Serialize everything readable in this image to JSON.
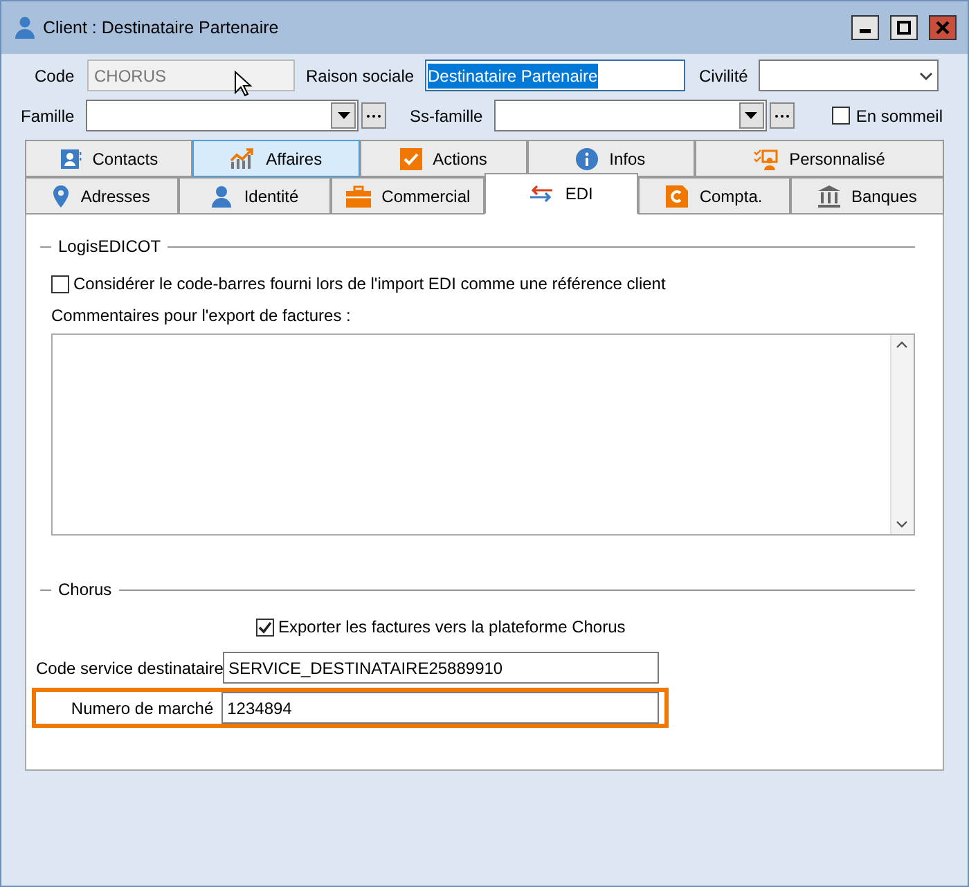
{
  "window": {
    "title": "Client : Destinataire Partenaire"
  },
  "header": {
    "code": {
      "label": "Code",
      "value": "CHORUS",
      "disabled": true
    },
    "raison_sociale": {
      "label": "Raison sociale",
      "value": "Destinataire Partenaire",
      "selected": true
    },
    "civilite": {
      "label": "Civilité"
    },
    "famille": {
      "label": "Famille"
    },
    "ss_famille": {
      "label": "Ss-famille"
    },
    "en_sommeil": {
      "label": "En sommeil",
      "checked": false
    }
  },
  "tab_rows": [
    [
      {
        "label": "Contacts",
        "selected": false,
        "hover": false
      },
      {
        "label": "Affaires",
        "selected": false,
        "hover": true
      },
      {
        "label": "Actions",
        "selected": false,
        "hover": false
      },
      {
        "label": "Infos",
        "selected": false,
        "hover": false
      },
      {
        "label": "Personnalisé",
        "selected": false,
        "hover": false
      }
    ],
    [
      {
        "label": "Adresses",
        "selected": false,
        "hover": false
      },
      {
        "label": "Identité",
        "selected": false,
        "hover": false
      },
      {
        "label": "Commercial",
        "selected": false,
        "hover": false
      },
      {
        "label": "EDI",
        "selected": true,
        "hover": false
      },
      {
        "label": "Compta.",
        "selected": false,
        "hover": false
      },
      {
        "label": "Banques",
        "selected": false,
        "hover": false
      }
    ]
  ],
  "logisedicot": {
    "title": "LogisEDICOT",
    "checkbox": {
      "label": "Considérer le code-barres fourni lors de l'import EDI comme une référence client",
      "checked": false
    },
    "comments_label": "Commentaires pour l'export de factures :"
  },
  "chorus": {
    "title": "Chorus",
    "checkbox": {
      "label": "Exporter les factures vers la plateforme Chorus",
      "checked": true
    },
    "fields": [
      {
        "label": "Code service destinataire",
        "value": "SERVICE_DESTINATAIRE25889910",
        "highlighted": false
      },
      {
        "label": "Numero de marché",
        "value": "1234894",
        "highlighted": true
      }
    ]
  }
}
